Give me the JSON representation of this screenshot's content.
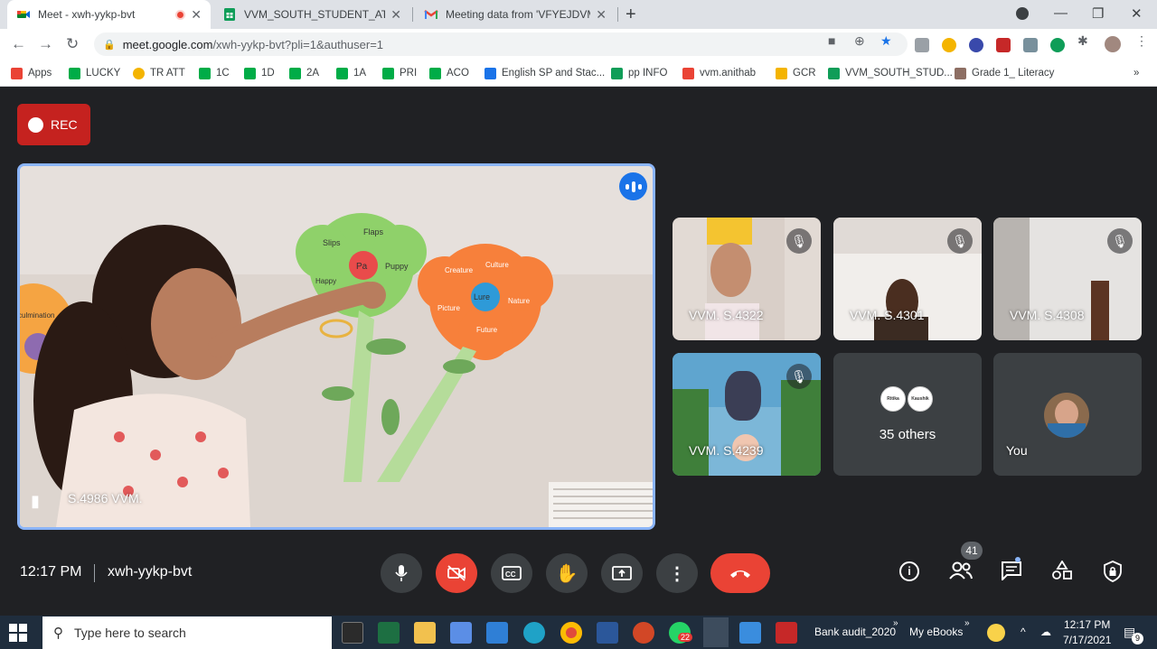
{
  "browser": {
    "tabs": [
      {
        "title": "Meet - xwh-yykp-bvt",
        "recording": true
      },
      {
        "title": "VVM_SOUTH_STUDENT_ATTENDA"
      },
      {
        "title": "Meeting data from 'VFYEJDVMZK"
      }
    ],
    "new_tab": "+",
    "window_controls": {
      "minimize": "—",
      "restore": "❐",
      "close": "✕"
    },
    "url_host": "meet.google.com",
    "url_path": "/xwh-yykp-bvt?pli=1&authuser=1",
    "bookmarks": [
      {
        "label": "Apps",
        "color": "#ea4335"
      },
      {
        "label": "LUCKY",
        "color": "#00ac47"
      },
      {
        "label": "TR ATT",
        "color": "#f4b400"
      },
      {
        "label": "1C",
        "color": "#00ac47"
      },
      {
        "label": "1D",
        "color": "#00ac47"
      },
      {
        "label": "2A",
        "color": "#00ac47"
      },
      {
        "label": "1A",
        "color": "#00ac47"
      },
      {
        "label": "PRI",
        "color": "#00ac47"
      },
      {
        "label": "ACO",
        "color": "#00ac47"
      },
      {
        "label": "English SP and Stac...",
        "color": "#1a73e8"
      },
      {
        "label": "pp INFO",
        "color": "#0f9d58"
      },
      {
        "label": "vvm.anithab",
        "color": "#ea4335"
      },
      {
        "label": "GCR",
        "color": "#f4b400"
      },
      {
        "label": "VVM_SOUTH_STUD...",
        "color": "#0f9d58"
      },
      {
        "label": "Grade 1_ Literacy",
        "color": "#8d6e63"
      }
    ],
    "bookmarks_overflow": "»"
  },
  "meet": {
    "rec_label": "REC",
    "main_tile": {
      "name": "S.4986 VVM.",
      "flower1_words": [
        "Flaps",
        "Slips",
        "Pa",
        "Puppy",
        "Happy"
      ],
      "flower2_words": [
        "Lure",
        "Culture",
        "Nature",
        "Picture",
        "Future",
        "Creature"
      ],
      "side_word": "culmination"
    },
    "participants": [
      {
        "name": "VVM. S.4322",
        "muted": true
      },
      {
        "name": "VVM. S.4301",
        "muted": true
      },
      {
        "name": "VVM. S.4308",
        "muted": true
      },
      {
        "name": "VVM. S.4239",
        "muted": true
      }
    ],
    "others": {
      "label": "35 others",
      "avatars": [
        "Ritika",
        "Kaushik"
      ]
    },
    "self_label": "You",
    "time": "12:17 PM",
    "meeting_code": "xwh-yykp-bvt",
    "people_count": "41",
    "accent": "#8ab4f8",
    "end_call_color": "#ea4335"
  },
  "taskbar": {
    "search_placeholder": "Type here to search",
    "pinned": [
      "Bank audit_2020",
      "My eBooks"
    ],
    "whatsapp_badge": "22",
    "clock_time": "12:17 PM",
    "clock_date": "7/17/2021",
    "notification_count": "9"
  }
}
